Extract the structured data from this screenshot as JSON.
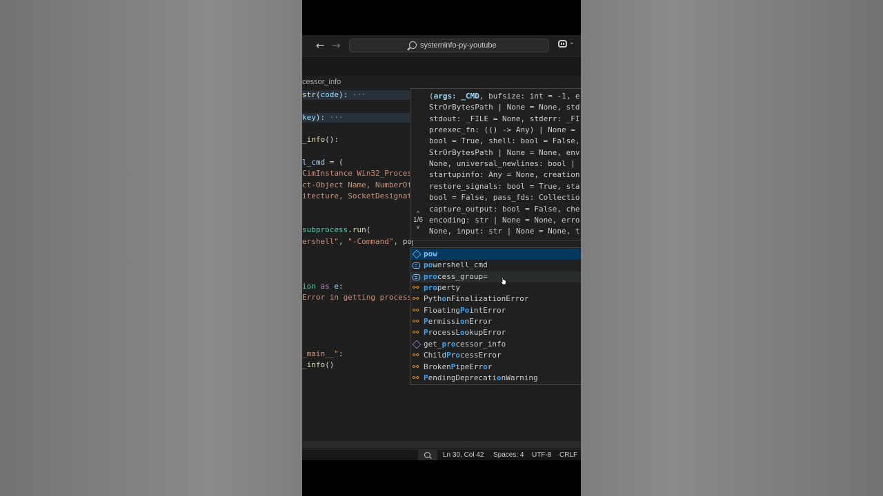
{
  "window": {
    "search_text": "systeminfo-py-youtube",
    "nav_back": "←",
    "nav_forward": "→",
    "copilot_chevron": "⌄"
  },
  "breadcrumb": "cessor_info",
  "code_lines": [
    {
      "parts": [
        {
          "t": "str",
          "c": "fn"
        },
        {
          "t": "(",
          "c": "pun"
        },
        {
          "t": "code",
          "c": "var"
        },
        {
          "t": "):",
          "c": "pun"
        },
        {
          "t": " ···",
          "c": "fold"
        }
      ],
      "highlight": true
    },
    {
      "parts": [],
      "highlight": false
    },
    {
      "parts": [
        {
          "t": "key",
          "c": "var"
        },
        {
          "t": "):",
          "c": "pun"
        },
        {
          "t": " ···",
          "c": "fold"
        }
      ],
      "highlight": true
    },
    {
      "parts": [],
      "highlight": false
    },
    {
      "parts": [
        {
          "t": "_info",
          "c": "fn"
        },
        {
          "t": "():",
          "c": "pun"
        }
      ],
      "highlight": false
    },
    {
      "parts": [],
      "highlight": false
    },
    {
      "parts": [
        {
          "t": "l_cmd",
          "c": "var"
        },
        {
          "t": " = (",
          "c": "pun"
        }
      ],
      "highlight": false
    },
    {
      "parts": [
        {
          "t": "CimInstance Win32_Proces",
          "c": "str"
        }
      ],
      "highlight": false
    },
    {
      "parts": [
        {
          "t": "ct-Object Name, NumberOf",
          "c": "str"
        }
      ],
      "highlight": false
    },
    {
      "parts": [
        {
          "t": "itecture, SocketDesignat",
          "c": "str"
        }
      ],
      "highlight": false
    },
    {
      "parts": [],
      "highlight": false
    },
    {
      "parts": [],
      "highlight": false
    },
    {
      "parts": [
        {
          "t": "subprocess",
          "c": "cls"
        },
        {
          "t": ".",
          "c": "pun"
        },
        {
          "t": "run",
          "c": "fn"
        },
        {
          "t": "(",
          "c": "pun"
        }
      ],
      "highlight": false
    },
    {
      "parts": [
        {
          "t": "ershell\"",
          "c": "str"
        },
        {
          "t": ", ",
          "c": "pun"
        },
        {
          "t": "\"-Command\"",
          "c": "str"
        },
        {
          "t": ", po",
          "c": "pl"
        }
      ],
      "highlight": false,
      "cursor": true
    },
    {
      "parts": [],
      "highlight": false
    },
    {
      "parts": [],
      "highlight": false
    },
    {
      "parts": [],
      "highlight": false
    },
    {
      "parts": [
        {
          "t": "ion",
          "c": "cls"
        },
        {
          "t": " as ",
          "c": "kw"
        },
        {
          "t": "e",
          "c": "var"
        },
        {
          "t": ":",
          "c": "pun"
        }
      ],
      "highlight": false
    },
    {
      "parts": [
        {
          "t": "Error in getting process",
          "c": "str"
        }
      ],
      "highlight": false
    },
    {
      "parts": [],
      "highlight": false
    },
    {
      "parts": [],
      "highlight": false
    },
    {
      "parts": [],
      "highlight": false
    },
    {
      "parts": [],
      "highlight": false
    },
    {
      "parts": [
        {
          "t": "_main__\"",
          "c": "str"
        },
        {
          "t": ":",
          "c": "pun"
        }
      ],
      "highlight": false
    },
    {
      "parts": [
        {
          "t": "_info",
          "c": "fn"
        },
        {
          "t": "()",
          "c": "pun"
        }
      ],
      "highlight": false
    }
  ],
  "signature_help": {
    "counter": "1/6",
    "up_arrow": "^",
    "down_arrow": "v",
    "lines": [
      "(args: _CMD, bufsize: int = -1, e",
      "StrOrBytesPath | None = None, std",
      "stdout: _FILE = None, stderr: _FI",
      "preexec_fn: (() -> Any) | None = ",
      "bool = True, shell: bool = False,",
      "StrOrBytesPath | None = None, env",
      "None, universal_newlines: bool | ",
      "startupinfo: Any = None, creation",
      "restore_signals: bool = True, sta",
      "bool = False, pass_fds: Collectio",
      "capture_output: bool = False, che",
      "encoding: str | None = None, erro",
      "None, input: str | None = None, t"
    ]
  },
  "suggestions": [
    {
      "segs": [
        {
          "t": "pow",
          "m": true
        }
      ],
      "icon": "box",
      "selected": true
    },
    {
      "segs": [
        {
          "t": "po",
          "m": true
        },
        {
          "t": "wershell_cmd",
          "m": false
        }
      ],
      "icon": "var"
    },
    {
      "segs": [
        {
          "t": "pro",
          "m": true
        },
        {
          "t": "cess_group=",
          "m": false
        }
      ],
      "icon": "var",
      "hover": true
    },
    {
      "segs": [
        {
          "t": "pro",
          "m": true
        },
        {
          "t": "perty",
          "m": false
        }
      ],
      "icon": "class"
    },
    {
      "segs": [
        {
          "t": "Pyth",
          "m": false
        },
        {
          "t": "o",
          "m": true
        },
        {
          "t": "nFinalizationError",
          "m": false
        }
      ],
      "icon": "class"
    },
    {
      "segs": [
        {
          "t": "Floating",
          "m": false
        },
        {
          "t": "Po",
          "m": true
        },
        {
          "t": "intError",
          "m": false
        }
      ],
      "icon": "class"
    },
    {
      "segs": [
        {
          "t": "P",
          "m": true
        },
        {
          "t": "ermissi",
          "m": false
        },
        {
          "t": "o",
          "m": true
        },
        {
          "t": "nError",
          "m": false
        }
      ],
      "icon": "class"
    },
    {
      "segs": [
        {
          "t": "P",
          "m": true
        },
        {
          "t": "rocessL",
          "m": false
        },
        {
          "t": "o",
          "m": true
        },
        {
          "t": "okupError",
          "m": false
        }
      ],
      "icon": "class"
    },
    {
      "segs": [
        {
          "t": "get_",
          "m": false
        },
        {
          "t": "p",
          "m": true
        },
        {
          "t": "r",
          "m": false
        },
        {
          "t": "o",
          "m": true
        },
        {
          "t": "cessor_info",
          "m": false
        }
      ],
      "icon": "fn"
    },
    {
      "segs": [
        {
          "t": "Child",
          "m": false
        },
        {
          "t": "P",
          "m": true
        },
        {
          "t": "r",
          "m": false
        },
        {
          "t": "o",
          "m": true
        },
        {
          "t": "cessError",
          "m": false
        }
      ],
      "icon": "class"
    },
    {
      "segs": [
        {
          "t": "Broken",
          "m": false
        },
        {
          "t": "P",
          "m": true
        },
        {
          "t": "ipeErr",
          "m": false
        },
        {
          "t": "o",
          "m": true
        },
        {
          "t": "r",
          "m": false
        }
      ],
      "icon": "class"
    },
    {
      "segs": [
        {
          "t": "P",
          "m": true
        },
        {
          "t": "endingDeprecati",
          "m": false
        },
        {
          "t": "o",
          "m": true
        },
        {
          "t": "nWarning",
          "m": false
        }
      ],
      "icon": "class"
    }
  ],
  "statusbar": {
    "position": "Ln 30, Col 42",
    "spaces": "Spaces: 4",
    "encoding": "UTF-8",
    "eol": "CRLF"
  },
  "colors": {
    "selection": "#04395e",
    "match": "#2aaaff",
    "editor_bg": "#1f1f1f"
  }
}
